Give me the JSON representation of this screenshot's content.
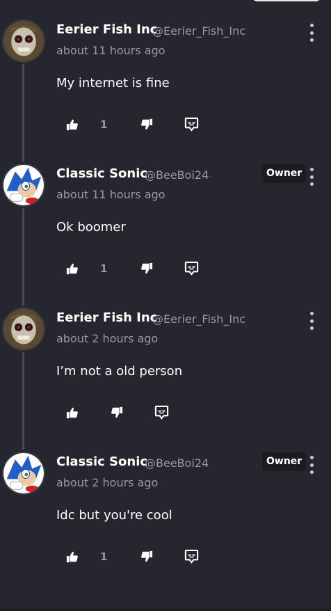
{
  "comments": [
    {
      "author": "Eerier Fish Inc",
      "handle": "@Eerier_Fish_Inc",
      "time": "about 11 hours ago",
      "text": "My internet is fine",
      "likes": "1",
      "owner_badge": "",
      "avatar": "skull-avatar-icon"
    },
    {
      "author": "Classic Sonic",
      "handle": "@BeeBoi24",
      "time": "about 11 hours ago",
      "text": "Ok boomer",
      "likes": "1",
      "owner_badge": "Owner",
      "avatar": "sonic-avatar-icon"
    },
    {
      "author": "Eerier Fish Inc",
      "handle": "@Eerier_Fish_Inc",
      "time": "about 2 hours ago",
      "text": "I’m not a old person",
      "likes": "",
      "owner_badge": "",
      "avatar": "skull-avatar-icon"
    },
    {
      "author": "Classic Sonic",
      "handle": "@BeeBoi24",
      "time": "about 2 hours ago",
      "text": "Idc but you're cool",
      "likes": "1",
      "owner_badge": "Owner",
      "avatar": "sonic-avatar-icon"
    }
  ],
  "colors": {
    "background": "#26262f",
    "muted_text": "#9a9aa6",
    "badge_bg": "#1b1b22"
  }
}
